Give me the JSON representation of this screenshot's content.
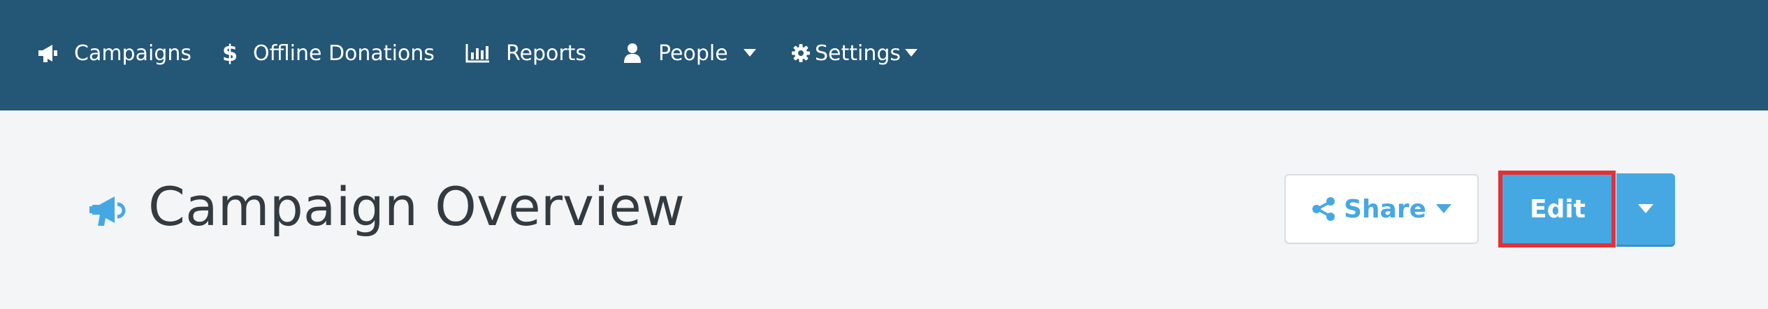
{
  "nav": {
    "items": [
      {
        "label": "Campaigns",
        "icon": "megaphone-icon"
      },
      {
        "label": "Offline Donations",
        "icon": "dollar-icon"
      },
      {
        "label": "Reports",
        "icon": "bar-chart-icon"
      },
      {
        "label": "People",
        "icon": "user-icon",
        "has_dropdown": true
      },
      {
        "label": "Settings",
        "icon": "gear-icon",
        "has_dropdown": true
      }
    ]
  },
  "page": {
    "title": "Campaign Overview",
    "title_icon": "megaphone-icon"
  },
  "actions": {
    "share_label": "Share",
    "edit_label": "Edit"
  },
  "colors": {
    "nav_bg": "#245676",
    "accent": "#46a8e3",
    "highlight": "#e23137",
    "title_text": "#333b41",
    "page_bg": "#f4f5f7"
  }
}
